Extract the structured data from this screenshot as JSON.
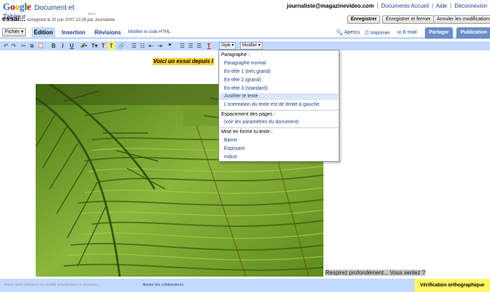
{
  "logo": {
    "letters": [
      "G",
      "o",
      "o",
      "g",
      "l",
      "e"
    ],
    "product": "Document et Tableur",
    "beta": "BETA"
  },
  "colors": {
    "google_letters": [
      "#3366cc",
      "#cc0000",
      "#e8a400",
      "#3366cc",
      "#109618",
      "#cc0000"
    ]
  },
  "header": {
    "user_email": "journaliste@magazinevideo.com",
    "links": [
      "Documents Accueil",
      "Aide",
      "Déconnexion"
    ],
    "doc_title": "essai...",
    "doc_info": "enregistré le 20 juin 2007 22:26 par Journaliste",
    "buttons": {
      "save": "Enregistrer",
      "save_close": "Enregistrer et fermer",
      "cancel": "Annuler les modifications"
    }
  },
  "tabs": {
    "fichier": "Fichier ▾",
    "items": [
      "Édition",
      "Insertion",
      "Révisions"
    ],
    "html_link": "Modifier le code HTML",
    "apercu": "Aperçu",
    "imprimer": "Imprimer",
    "email": "E-mail",
    "partager": "Partager",
    "publication": "Publication"
  },
  "toolbar": {
    "undo": "↶",
    "redo": "↷",
    "cut": "✂",
    "copy": "⧉",
    "paste": "📋",
    "bold": "B",
    "italic": "I",
    "underline": "U",
    "font": "𝓕▾",
    "size": "T▾",
    "fg_color": "T",
    "bg_color": "T",
    "link": "🔗",
    "ol": "☰",
    "ul": "☷",
    "outdent": "⇤",
    "indent": "⇥",
    "quote": "❝",
    "align_left": "☰",
    "align_center": "☰",
    "align_right": "☰",
    "clear": "T",
    "style_menu": "Style ▾",
    "modify_menu": "Modifier ▾"
  },
  "document": {
    "heading": "Voici un essai depuis l",
    "caption": "Respirez profondément... Vous sentez ?"
  },
  "menu": {
    "sections": [
      {
        "header": "Paragraphe :",
        "items": [
          "Paragraphe normal",
          "En-tête 1 (très grand)",
          "En-tête 2 (grand)",
          "En-tête 3 (standard)",
          "Justifier le texte",
          "L'orientation du texte est de droite à gauche."
        ]
      },
      {
        "header": "Espacement des pages :",
        "items": [
          "(voir les paramètres du document)"
        ]
      },
      {
        "header": "Mise en forme tu texte :",
        "items": [
          "Barrer",
          "Exposant",
          "Indice"
        ]
      }
    ],
    "highlighted": "Justifier le texte"
  },
  "status": {
    "text": "Aucun autre utilisateur ne modifie actuellement ce document.",
    "add_collaborators": "Ajouter des collaborateurs",
    "spellcheck": "Vérification orthographique"
  }
}
